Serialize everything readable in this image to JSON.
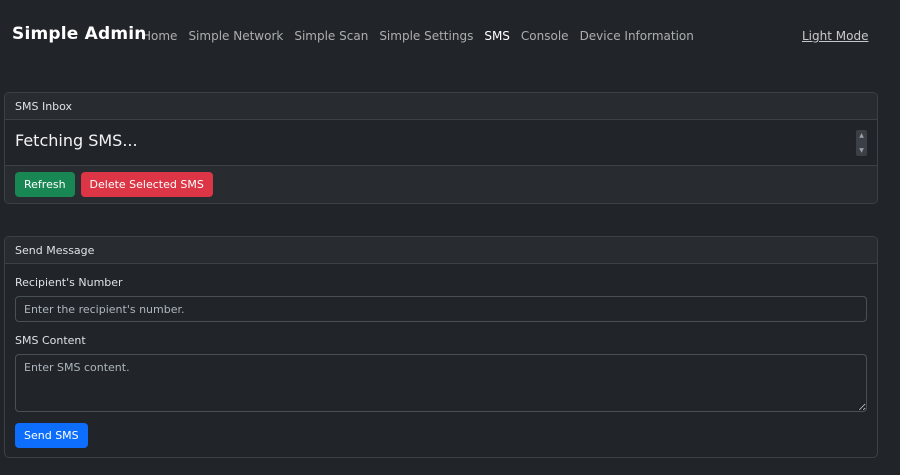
{
  "navbar": {
    "brand": "Simple Admin",
    "links": [
      {
        "label": "Home"
      },
      {
        "label": "Simple Network"
      },
      {
        "label": "Simple Scan"
      },
      {
        "label": "Simple Settings"
      },
      {
        "label": "SMS",
        "active": true
      },
      {
        "label": "Console"
      },
      {
        "label": "Device Information"
      }
    ],
    "mode_toggle": "Light Mode"
  },
  "inbox": {
    "header": "SMS Inbox",
    "status": "Fetching SMS...",
    "refresh_label": "Refresh",
    "delete_label": "Delete Selected SMS"
  },
  "send": {
    "header": "Send Message",
    "recipient_label": "Recipient's Number",
    "recipient_placeholder": "Enter the recipient's number.",
    "content_label": "SMS Content",
    "content_placeholder": "Enter SMS content.",
    "send_label": "Send SMS"
  },
  "colors": {
    "background": "#212529",
    "success": "#198754",
    "danger": "#dc3545",
    "primary": "#0d6efd"
  }
}
